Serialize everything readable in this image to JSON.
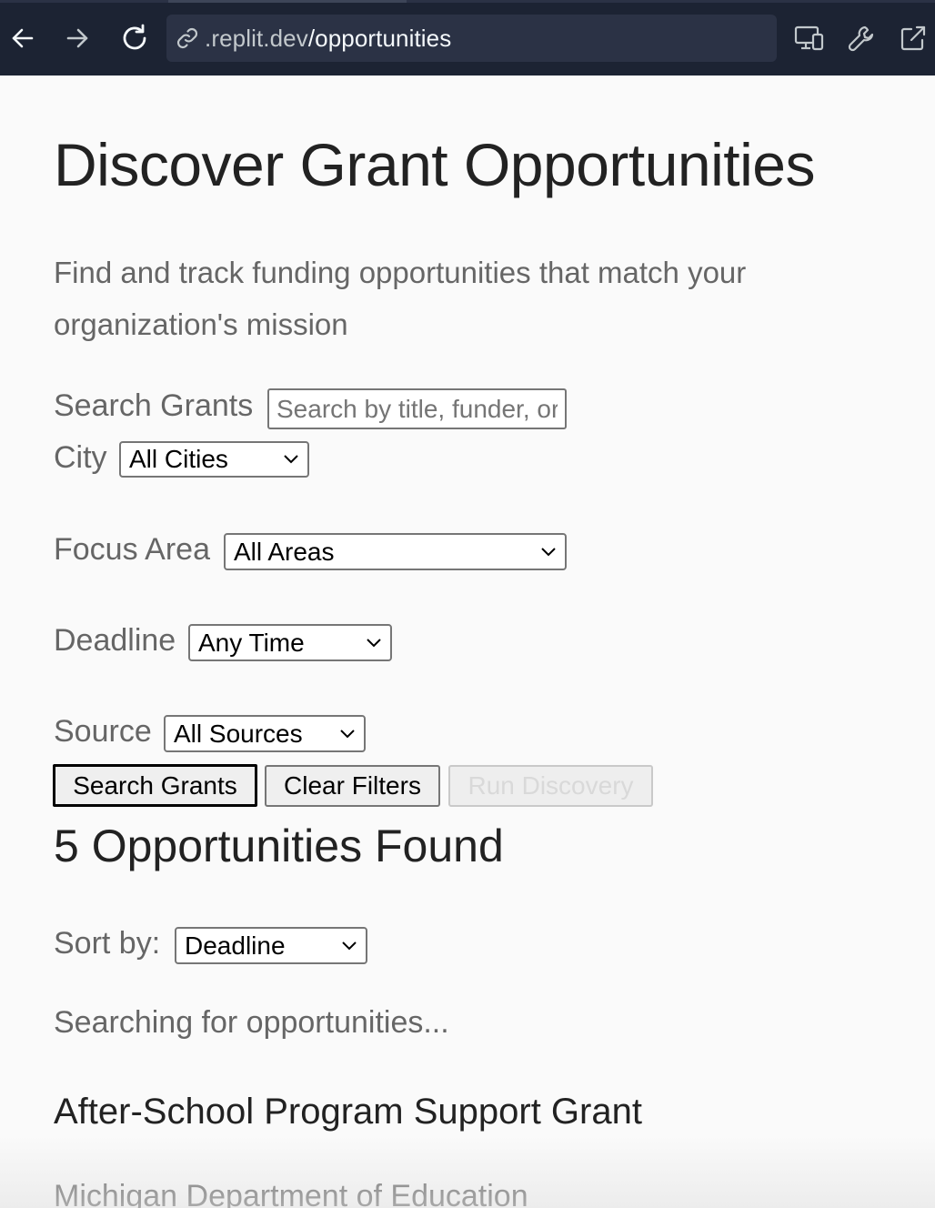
{
  "browser": {
    "url_prefix": ".replit.dev",
    "url_path": "/opportunities"
  },
  "page": {
    "title": "Discover Grant Opportunities",
    "subtitle": "Find and track funding opportunities that match your organization's mission"
  },
  "filters": {
    "search_label": "Search Grants",
    "search_placeholder": "Search by title, funder, or keyword",
    "search_value": "",
    "city_label": "City",
    "city_value": "All Cities",
    "focus_label": "Focus Area",
    "focus_value": "All Areas",
    "deadline_label": "Deadline",
    "deadline_value": "Any Time",
    "source_label": "Source",
    "source_value": "All Sources"
  },
  "actions": {
    "search_button": "Search Grants",
    "clear_button": "Clear Filters",
    "discovery_button": "Run Discovery"
  },
  "results": {
    "heading": "5 Opportunities Found",
    "sort_label": "Sort by:",
    "sort_value": "Deadline",
    "status": "Searching for opportunities..."
  },
  "grants": [
    {
      "title": "After-School Program Support Grant",
      "funder": "Michigan Department of Education"
    }
  ],
  "colors": {
    "browser_bar": "#1c2333",
    "url_box": "#2b3245",
    "page_bg": "#fafafa",
    "heading_text": "#222222",
    "muted_text": "#666666"
  },
  "icons": {
    "back": "arrow-left-icon",
    "forward": "arrow-right-icon",
    "reload": "reload-icon",
    "link": "link-icon",
    "devices": "devices-icon",
    "devtools": "wrench-icon",
    "open_external": "external-link-icon",
    "select": "chevron-down-icon"
  }
}
